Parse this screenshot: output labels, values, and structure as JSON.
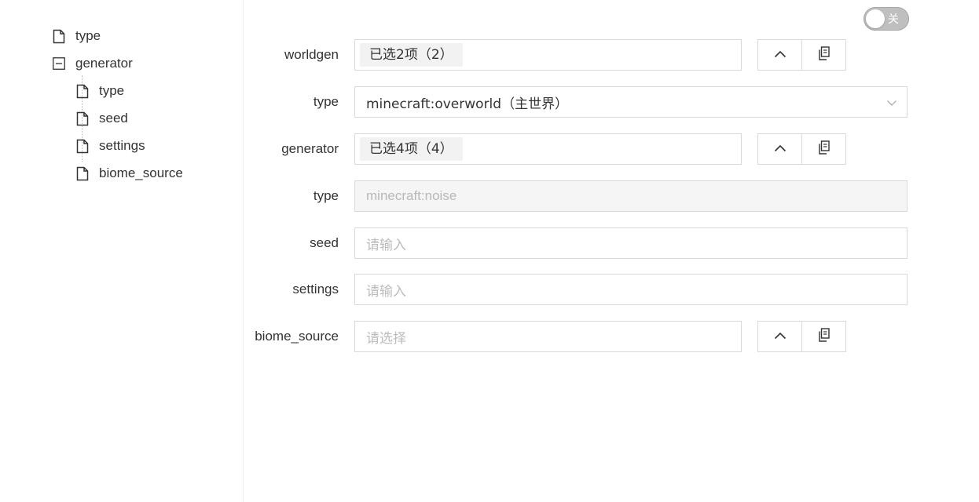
{
  "tree": {
    "items": [
      {
        "label": "type",
        "icon": "file-icon"
      },
      {
        "label": "generator",
        "icon": "collapse-icon"
      },
      {
        "label": "type",
        "icon": "file-icon"
      },
      {
        "label": "seed",
        "icon": "file-icon"
      },
      {
        "label": "settings",
        "icon": "file-icon"
      },
      {
        "label": "biome_source",
        "icon": "file-icon"
      }
    ]
  },
  "toggle": {
    "label": "关",
    "state": "off"
  },
  "form": {
    "worldgen": {
      "label": "worldgen",
      "tag": "已选2项（2）"
    },
    "type": {
      "label": "type",
      "value": "minecraft:overworld（主世界）"
    },
    "generator": {
      "label": "generator",
      "tag": "已选4项（4）"
    },
    "gen_type": {
      "label": "type",
      "value": "minecraft:noise"
    },
    "seed": {
      "label": "seed",
      "placeholder": "请输入"
    },
    "settings": {
      "label": "settings",
      "placeholder": "请输入"
    },
    "biome_source": {
      "label": "biome_source",
      "placeholder": "请选择"
    }
  },
  "icons": {
    "collapse": "chevron-up-icon",
    "copy": "copy-icon",
    "dropdown": "chevron-down-icon"
  }
}
